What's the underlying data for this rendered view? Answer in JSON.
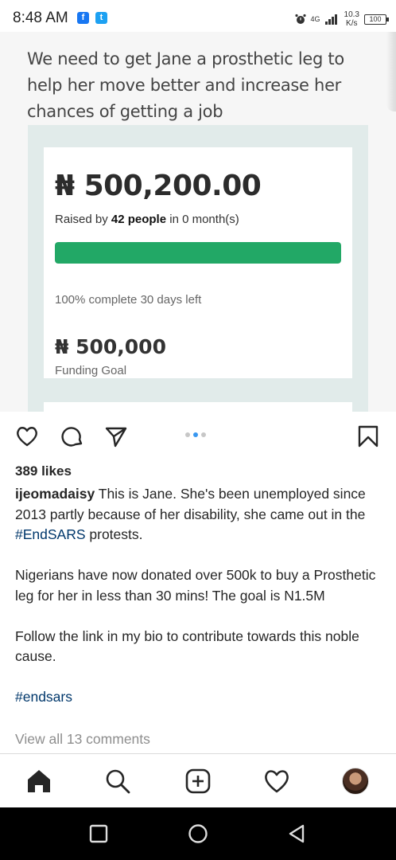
{
  "status_bar": {
    "time": "8:48 AM",
    "network": "4G",
    "speed_value": "10.3",
    "speed_unit": "K/s",
    "battery": "100"
  },
  "post_image": {
    "headline": "We need to get Jane a prosthetic leg to help her move better and increase her chances of getting a job",
    "raised_amount": "₦ 500,200.00",
    "raised_by_prefix": "Raised by ",
    "raised_by_count": "42 people",
    "raised_by_suffix": " in 0 month(s)",
    "progress_fraction": 1.0,
    "progress_text": "100% complete 30 days left",
    "goal_amount": "₦ 500,000",
    "goal_label": "Funding Goal",
    "progress_color": "#22a866"
  },
  "actions": {
    "icons": [
      "heart-icon",
      "comment-icon",
      "share-icon",
      "bookmark-icon"
    ],
    "carousel_active_index": 1,
    "carousel_count": 3
  },
  "post": {
    "likes": "389 likes",
    "username": "ijeomadaisy",
    "caption_p1_text": " This is Jane. She's been unemployed since 2013 partly because of her disability, she came out in the ",
    "caption_p1_tag": "#EndSARS",
    "caption_p1_end": " protests.",
    "caption_p2": "Nigerians have now donated over 500k to buy a Prosthetic leg for her in less than 30 mins! The goal is N1.5M",
    "caption_p3": "Follow the link in my bio to contribute towards this noble cause.",
    "caption_tag": "#endsars",
    "view_comments": "View all 13 comments",
    "hashtag_color": "#00376b"
  },
  "bottom_nav": {
    "icons": [
      "home-icon",
      "search-icon",
      "new-post-icon",
      "activity-icon",
      "profile-avatar"
    ]
  }
}
